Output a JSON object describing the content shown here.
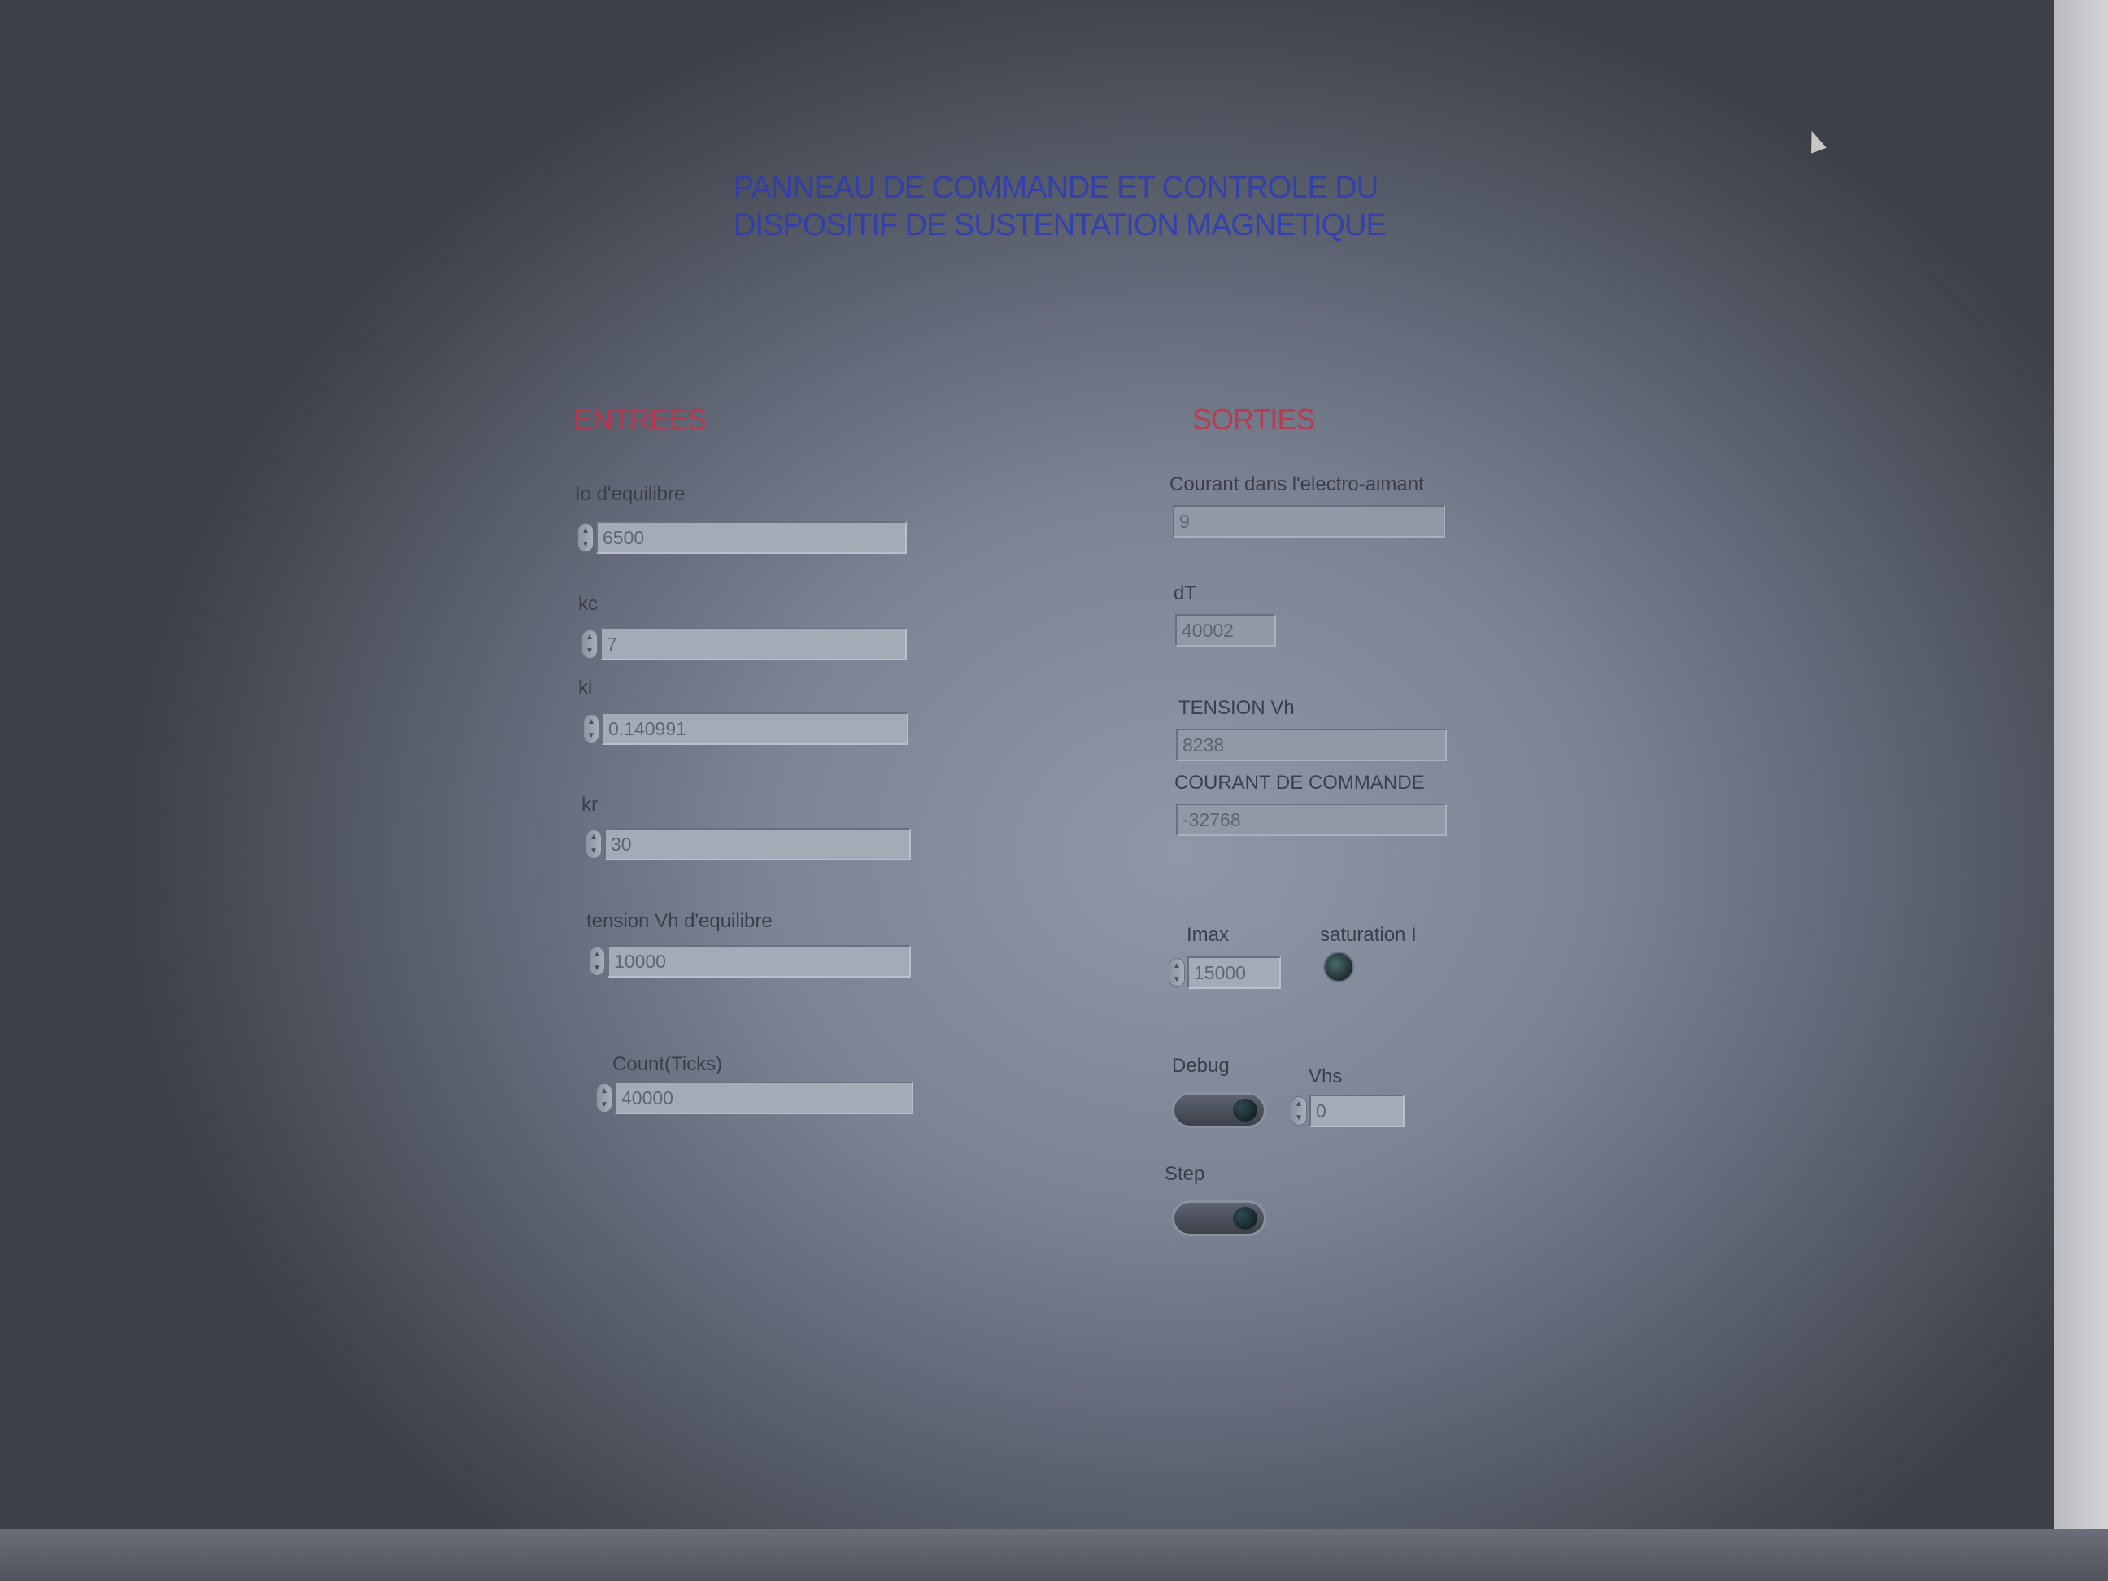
{
  "title": {
    "line1": "PANNEAU DE COMMANDE ET CONTROLE DU",
    "line2": "DISPOSITIF DE SUSTENTATION MAGNETIQUE"
  },
  "inputs": {
    "section_label": "ENTREES",
    "io": {
      "label": "Io d'equilibre",
      "value": "6500"
    },
    "kc": {
      "label": "kc",
      "value": "7"
    },
    "ki": {
      "label": "ki",
      "value": "0.140991"
    },
    "kr": {
      "label": "kr",
      "value": "30"
    },
    "vh_eq": {
      "label": "tension Vh d'equilibre",
      "value": "10000"
    },
    "count": {
      "label": "Count(Ticks)",
      "value": "40000"
    }
  },
  "outputs": {
    "section_label": "SORTIES",
    "courant": {
      "label": "Courant dans l'electro-aimant",
      "value": "9"
    },
    "dt": {
      "label": "dT",
      "value": "40002"
    },
    "tension": {
      "label": "TENSION Vh",
      "value": "8238"
    },
    "commande": {
      "label": "COURANT DE COMMANDE",
      "value": "-32768"
    },
    "imax": {
      "label": "Imax",
      "value": "15000"
    },
    "saturation": {
      "label": "saturation I"
    },
    "debug": {
      "label": "Debug"
    },
    "vhs": {
      "label": "Vhs",
      "value": "0"
    },
    "step": {
      "label": "Step"
    }
  },
  "colors": {
    "title": "#2e3cb8",
    "section": "#c8304a",
    "panel": "#8f98a9"
  }
}
